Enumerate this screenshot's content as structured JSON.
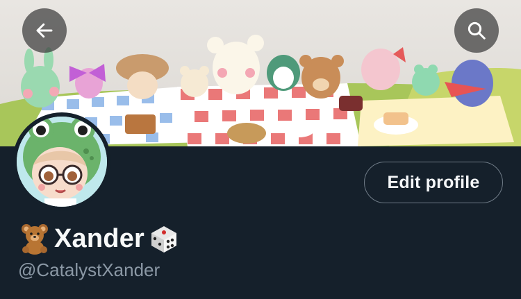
{
  "profile": {
    "display_name": "Xander",
    "handle": "@CatalystXander",
    "name_prefix_icon": "teddy-bear-emoji",
    "name_suffix_icon": "dice-emoji"
  },
  "actions": {
    "edit_profile_label": "Edit profile",
    "back_icon": "arrow-left-icon",
    "search_icon": "search-icon"
  },
  "banner": {
    "description_icon": "picnic-illustration"
  },
  "colors": {
    "background": "#15202b",
    "text_primary": "#f7f9f9",
    "text_secondary": "#8b98a5",
    "button_border": "#6f7b87"
  }
}
